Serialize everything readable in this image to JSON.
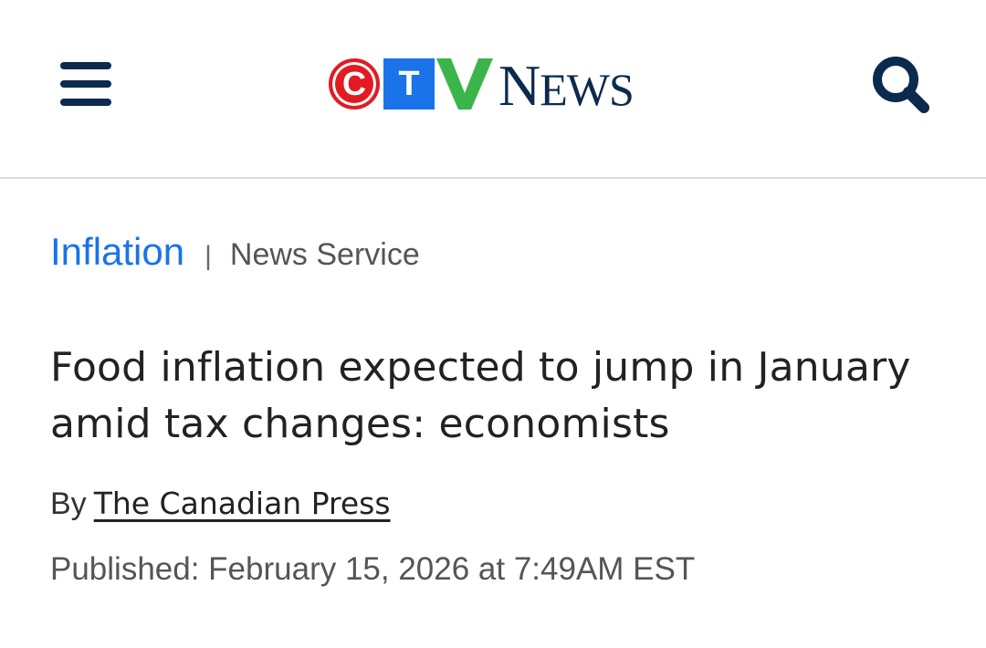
{
  "header": {
    "logo": {
      "letters": [
        "C",
        "T",
        "V"
      ],
      "word_first": "N",
      "word_rest": "EWS",
      "colors": {
        "c_red": "#e21b23",
        "t_blue": "#1a73e8",
        "v_green": "#3bb54a",
        "wordmark_navy": "#0b2a4d"
      }
    },
    "icons": {
      "menu": "hamburger-menu-icon",
      "search": "magnifier-search-icon"
    }
  },
  "article": {
    "category": "Inflation",
    "separator": "|",
    "source_label": "News Service",
    "headline": "Food inflation expected to jump in January amid tax changes: economists",
    "byline_prefix": "By",
    "author": "The Canadian Press",
    "published": "Published: February 15, 2026 at 7:49AM EST"
  },
  "colors": {
    "accent_blue": "#1a73e8",
    "text_dark": "#222222",
    "text_muted": "#555555",
    "divider": "#dcdcdc"
  }
}
